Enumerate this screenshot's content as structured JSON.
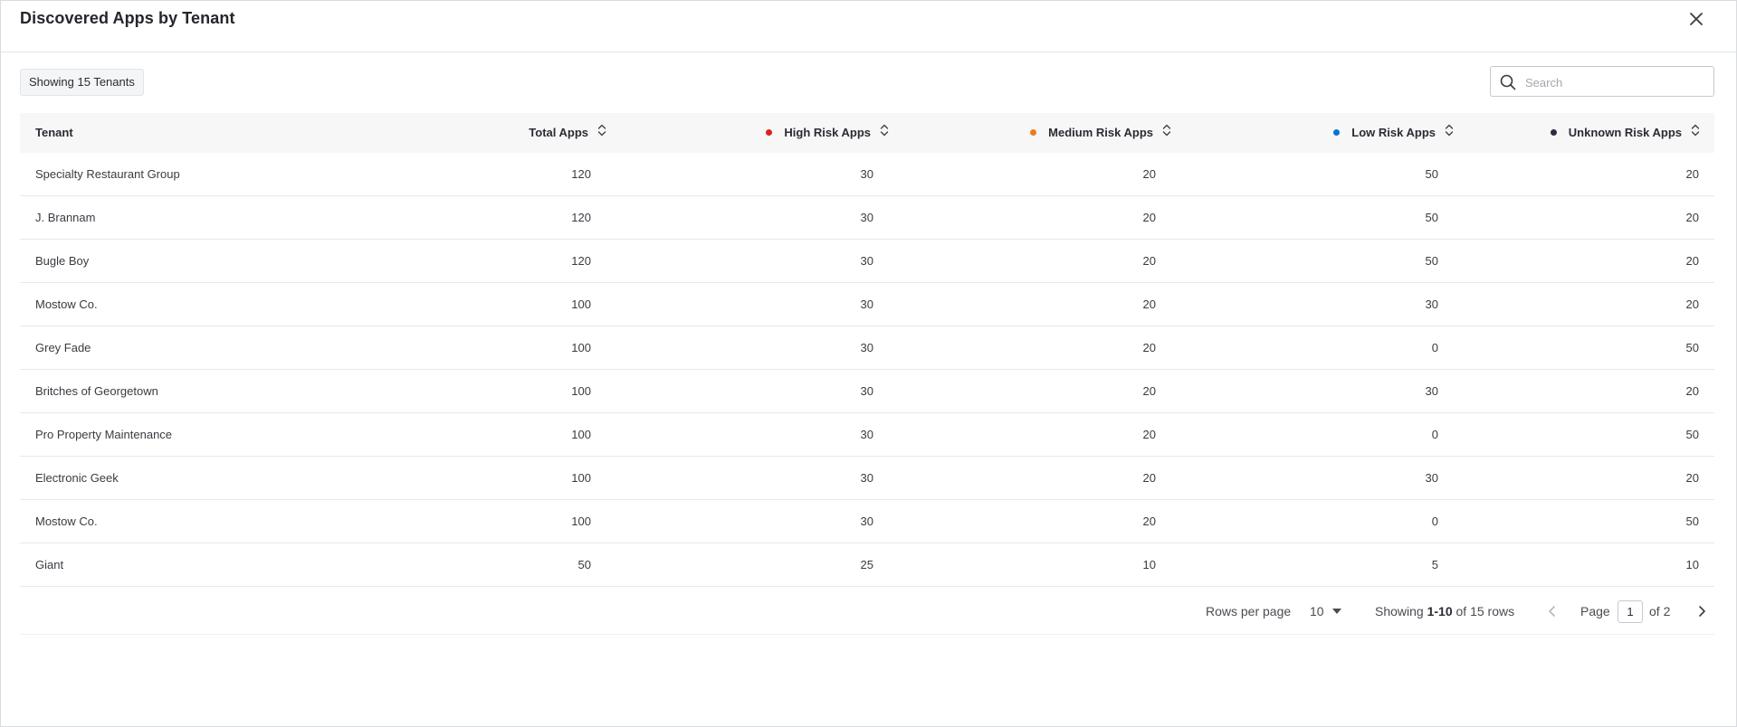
{
  "header": {
    "title": "Discovered Apps by Tenant"
  },
  "toolbar": {
    "count_badge": "Showing 15 Tenants",
    "search_placeholder": "Search"
  },
  "colors": {
    "high": "#e0201b",
    "medium": "#f07a1a",
    "low": "#0a72d0",
    "unknown": "#2b2d42"
  },
  "table": {
    "columns": [
      "Tenant",
      "Total Apps",
      "High Risk Apps",
      "Medium Risk Apps",
      "Low Risk Apps",
      "Unknown Risk Apps"
    ],
    "rows": [
      [
        "Specialty Restaurant Group",
        "120",
        "30",
        "20",
        "50",
        "20"
      ],
      [
        "J. Brannam",
        "120",
        "30",
        "20",
        "50",
        "20"
      ],
      [
        "Bugle Boy",
        "120",
        "30",
        "20",
        "50",
        "20"
      ],
      [
        "Mostow Co.",
        "100",
        "30",
        "20",
        "30",
        "20"
      ],
      [
        "Grey Fade",
        "100",
        "30",
        "20",
        "0",
        "50"
      ],
      [
        "Britches of Georgetown",
        "100",
        "30",
        "20",
        "30",
        "20"
      ],
      [
        "Pro Property Maintenance",
        "100",
        "30",
        "20",
        "0",
        "50"
      ],
      [
        "Electronic Geek",
        "100",
        "30",
        "20",
        "30",
        "20"
      ],
      [
        "Mostow Co.",
        "100",
        "30",
        "20",
        "0",
        "50"
      ],
      [
        "Giant",
        "50",
        "25",
        "10",
        "5",
        "10"
      ]
    ]
  },
  "pagination": {
    "rows_per_page_label": "Rows per page",
    "rows_per_page": "10",
    "showing_prefix": "Showing",
    "showing_range": "1-10",
    "showing_suffix": "of 15 rows",
    "page_label": "Page",
    "page": "1",
    "of_pages": "of 2"
  }
}
